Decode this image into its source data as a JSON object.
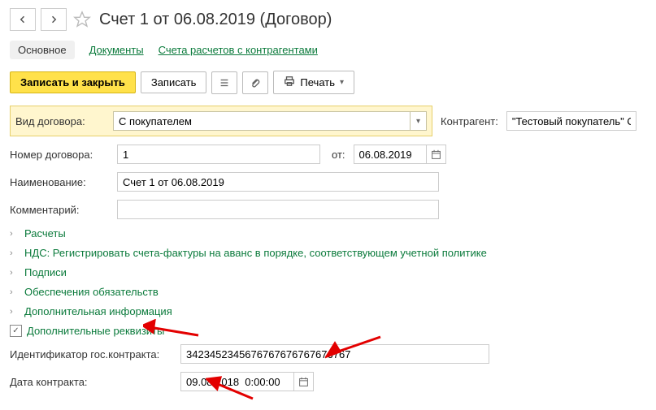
{
  "header": {
    "page_title": "Счет 1 от 06.08.2019 (Договор)"
  },
  "tabs": {
    "main": "Основное",
    "docs": "Документы",
    "settlements": "Счета расчетов с контрагентами"
  },
  "toolbar": {
    "save_close": "Записать и закрыть",
    "save": "Записать",
    "print": "Печать"
  },
  "form": {
    "contract_type_label": "Вид договора:",
    "contract_type_value": "С покупателем",
    "contractor_label": "Контрагент:",
    "contractor_value": "\"Тестовый покупатель\" ООО",
    "number_label": "Номер договора:",
    "number_value": "1",
    "from_label": "от:",
    "from_date": "06.08.2019",
    "name_label": "Наименование:",
    "name_value": "Счет 1 от 06.08.2019",
    "comment_label": "Комментарий:",
    "comment_value": ""
  },
  "sections": {
    "s1": "Расчеты",
    "s2": "НДС: Регистрировать счета-фактуры на аванс в порядке, соответствующем учетной политике",
    "s3": "Подписи",
    "s4": "Обеспечения обязательств",
    "s5": "Дополнительная информация",
    "s6": "Дополнительные реквизиты"
  },
  "bottom": {
    "gov_id_label": "Идентификатор гос.контракта:",
    "gov_id_value": "3423452345676767676767676767",
    "contract_date_label": "Дата контракта:",
    "contract_date_value": "09.08.2018  0:00:00"
  }
}
